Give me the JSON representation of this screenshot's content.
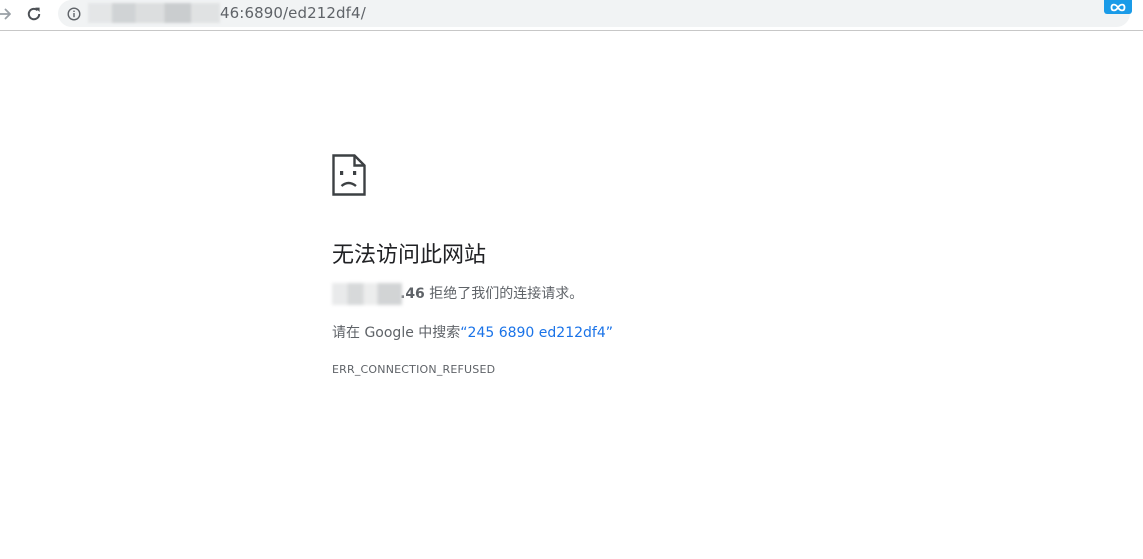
{
  "browser": {
    "url_visible": "46:6890/ed212df4/",
    "accent_color": "#1a73e8",
    "extension_color": "#1a9be8",
    "nav_icons": [
      "forward-icon",
      "reload-icon"
    ],
    "omnibox_icons": [
      "info-icon",
      "bookmark-star-icon"
    ]
  },
  "error_page": {
    "icon": "sad-file-icon",
    "title": "无法访问此网站",
    "host_suffix": ".46",
    "refused_text": " 拒绝了我们的连接请求。",
    "search_prefix": "请在 Google 中搜索",
    "search_query": "“245 6890 ed212df4”",
    "error_code": "ERR_CONNECTION_REFUSED"
  }
}
